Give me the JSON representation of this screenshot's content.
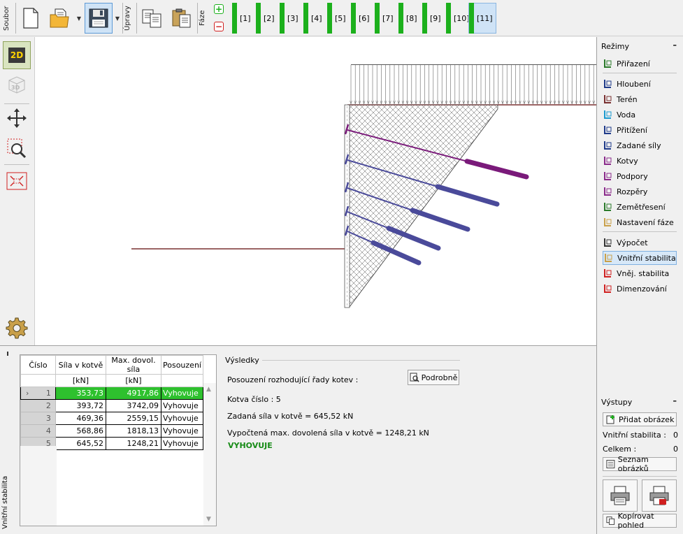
{
  "toolbar": {
    "file_tab": "Soubor",
    "edit_tab": "Úpravy",
    "phase_tab": "Fáze",
    "phases": [
      {
        "label": "[1]",
        "active": false
      },
      {
        "label": "[2]",
        "active": false
      },
      {
        "label": "[3]",
        "active": false
      },
      {
        "label": "[4]",
        "active": false
      },
      {
        "label": "[5]",
        "active": false
      },
      {
        "label": "[6]",
        "active": false
      },
      {
        "label": "[7]",
        "active": false
      },
      {
        "label": "[8]",
        "active": false
      },
      {
        "label": "[9]",
        "active": false
      },
      {
        "label": "[10]",
        "active": false
      },
      {
        "label": "[11]",
        "active": true
      }
    ],
    "phase_color": "#1cb01c"
  },
  "left_tools": {
    "view_2d": "2D",
    "view_3d": "3D"
  },
  "modes": {
    "header": "Režimy",
    "minimize": "–",
    "items": [
      {
        "label": "Přiřazení",
        "icon": "assignment-icon",
        "active": false
      },
      {
        "label": "Hloubení",
        "icon": "excavation-icon",
        "active": false
      },
      {
        "label": "Terén",
        "icon": "terrain-icon",
        "active": false
      },
      {
        "label": "Voda",
        "icon": "water-icon",
        "active": false
      },
      {
        "label": "Přitížení",
        "icon": "surcharge-icon",
        "active": false
      },
      {
        "label": "Zadané síly",
        "icon": "applied-forces-icon",
        "active": false
      },
      {
        "label": "Kotvy",
        "icon": "anchors-icon",
        "active": false
      },
      {
        "label": "Podpory",
        "icon": "supports-icon",
        "active": false
      },
      {
        "label": "Rozpěry",
        "icon": "props-icon",
        "active": false
      },
      {
        "label": "Zemětřesení",
        "icon": "earthquake-icon",
        "active": false
      },
      {
        "label": "Nastavení fáze",
        "icon": "stage-settings-icon",
        "active": false
      },
      {
        "label": "Výpočet",
        "icon": "analysis-icon",
        "active": false
      },
      {
        "label": "Vnitřní stabilita",
        "icon": "internal-stability-icon",
        "active": true
      },
      {
        "label": "Vněj. stabilita",
        "icon": "external-stability-icon",
        "active": false
      },
      {
        "label": "Dimenzování",
        "icon": "dimensioning-icon",
        "active": false
      }
    ]
  },
  "outputs": {
    "header": "Výstupy",
    "minimize": "–",
    "add_picture": "Přidat obrázek",
    "internal_stability_label": "Vnitřní stabilita :",
    "internal_stability_count": "0",
    "total_label": "Celkem :",
    "total_count": "0",
    "picture_list": "Seznam obrázků",
    "copy_view": "Kopírovat pohled"
  },
  "bottom": {
    "side_tab": "Vnitřní stabilita",
    "table": {
      "headers": [
        [
          "Číslo",
          ""
        ],
        [
          "Síla v kotvě",
          "[kN]"
        ],
        [
          "Max. dovol. síla",
          "[kN]"
        ],
        [
          "Posouzení",
          ""
        ]
      ],
      "rows": [
        {
          "num": "1",
          "force": "353,73",
          "max": "4917,86",
          "check": "Vyhovuje",
          "selected": true
        },
        {
          "num": "2",
          "force": "393,72",
          "max": "3742,09",
          "check": "Vyhovuje",
          "selected": false
        },
        {
          "num": "3",
          "force": "469,36",
          "max": "2559,15",
          "check": "Vyhovuje",
          "selected": false
        },
        {
          "num": "4",
          "force": "568,86",
          "max": "1818,13",
          "check": "Vyhovuje",
          "selected": false
        },
        {
          "num": "5",
          "force": "645,52",
          "max": "1248,21",
          "check": "Vyhovuje",
          "selected": false
        }
      ]
    },
    "results": {
      "legend": "Výsledky",
      "verification_line": "Posouzení rozhodující řady kotev :",
      "detail_button": "Podrobně",
      "anchor_number": "Kotva číslo : 5",
      "applied_force": "Zadaná síla v kotvě = 645,52 kN",
      "computed_force": "Vypočtená max. dovolená síla v kotvě = 1248,21 kN",
      "verdict": "VYHOVUJE",
      "verdict_color": "#178b17"
    }
  },
  "drawing": {
    "anchor_colors": [
      "#7a1a7a",
      "#4a4a9a",
      "#4a4a9a",
      "#4a4a9a",
      "#4a4a9a"
    ],
    "terrain_color": "#7a3030"
  }
}
